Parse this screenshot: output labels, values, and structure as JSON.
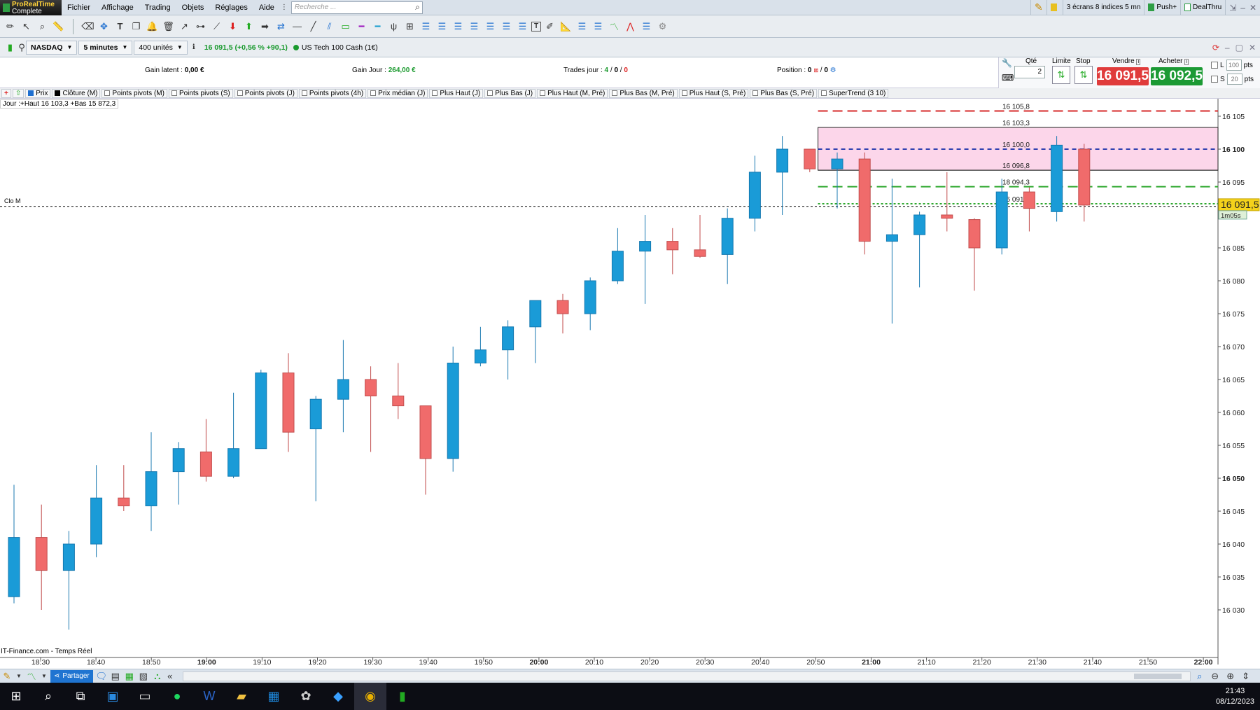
{
  "app": {
    "logo_title": "ProRealTime",
    "logo_sub": "Complete"
  },
  "menu": [
    "Fichier",
    "Affichage",
    "Trading",
    "Objets",
    "Réglages",
    "Aide"
  ],
  "search_placeholder": "Recherche ...",
  "topright": {
    "screens": "3 écrans 8 indices 5 mn",
    "push": "Push+",
    "dealthru": "DealThru"
  },
  "chart_header": {
    "instrument": "NASDAQ",
    "timeframe": "5 minutes",
    "units": "400 unités",
    "price_change": "16 091,5 (+0,56 % +90,1)",
    "instrument_name": "US Tech 100 Cash (1€)"
  },
  "trading": {
    "gain_latent_label": "Gain latent :",
    "gain_latent_value": "0,00 €",
    "gain_jour_label": "Gain Jour :",
    "gain_jour_value": "264,00 €",
    "trades_label": "Trades jour :",
    "trades_a": "4",
    "trades_b": "0",
    "trades_c": "0",
    "position_label": "Position :",
    "position_a": "0",
    "position_b": "0",
    "qty_label": "Qté",
    "qty_value": "2",
    "limit_label": "Limite",
    "stop_label": "Stop",
    "sell_label": "Vendre",
    "buy_label": "Acheter",
    "sell_price": "16 091,5",
    "buy_price": "16 092,5",
    "l_label": "L",
    "l_value": "100",
    "s_label": "S",
    "s_value": "20",
    "pts": "pts",
    "sell_color": "#e03b3b",
    "buy_color": "#1c9a34"
  },
  "indicators": [
    "Prix",
    "Clôture (M)",
    "Points pivots (M)",
    "Points pivots (S)",
    "Points pivots (J)",
    "Points pivots (4h)",
    "Prix médian (J)",
    "Plus Haut (J)",
    "Plus Bas (J)",
    "Plus Haut (M, Pré)",
    "Plus Bas (M, Pré)",
    "Plus Haut (S, Pré)",
    "Plus Bas (S, Pré)",
    "SuperTrend (3 10)"
  ],
  "chart_info": "Jour :+Haut 16 103,3 +Bas 15 872,3",
  "clo_label": "Clo M",
  "source": "IT-Finance.com - Temps Réel",
  "bottom": {
    "share": "Partager"
  },
  "clock": {
    "time": "21:43",
    "date": "08/12/2023"
  },
  "chart_data": {
    "type": "candlestick",
    "up_color": "#1a9bd7",
    "down_color": "#f06b6b",
    "ylim": [
      16026,
      16109
    ],
    "y_ticks": [
      {
        "v": 16030,
        "t": "16 030",
        "bold": false
      },
      {
        "v": 16035,
        "t": "16 035",
        "bold": false
      },
      {
        "v": 16040,
        "t": "16 040",
        "bold": false
      },
      {
        "v": 16045,
        "t": "16 045",
        "bold": false
      },
      {
        "v": 16050,
        "t": "16 050",
        "bold": true
      },
      {
        "v": 16055,
        "t": "16 055",
        "bold": false
      },
      {
        "v": 16060,
        "t": "16 060",
        "bold": false
      },
      {
        "v": 16065,
        "t": "16 065",
        "bold": false
      },
      {
        "v": 16070,
        "t": "16 070",
        "bold": false
      },
      {
        "v": 16075,
        "t": "16 075",
        "bold": false
      },
      {
        "v": 16080,
        "t": "16 080",
        "bold": false
      },
      {
        "v": 16085,
        "t": "16 085",
        "bold": false
      },
      {
        "v": 16090,
        "t": "16 090",
        "bold": false
      },
      {
        "v": 16095,
        "t": "16 095",
        "bold": false
      },
      {
        "v": 16100,
        "t": "16 100",
        "bold": true
      },
      {
        "v": 16105,
        "t": "16 105",
        "bold": false
      }
    ],
    "x_ticks": [
      {
        "i": 1,
        "t": "18:30",
        "bold": false
      },
      {
        "i": 3,
        "t": "18:40",
        "bold": false
      },
      {
        "i": 5,
        "t": "18:50",
        "bold": false
      },
      {
        "i": 7,
        "t": "19:00",
        "bold": true
      },
      {
        "i": 9,
        "t": "19:10",
        "bold": false
      },
      {
        "i": 11,
        "t": "19:20",
        "bold": false
      },
      {
        "i": 13,
        "t": "19:30",
        "bold": false
      },
      {
        "i": 15,
        "t": "19:40",
        "bold": false
      },
      {
        "i": 17,
        "t": "19:50",
        "bold": false
      },
      {
        "i": 19,
        "t": "20:00",
        "bold": true
      },
      {
        "i": 21,
        "t": "20:10",
        "bold": false
      },
      {
        "i": 23,
        "t": "20:20",
        "bold": false
      },
      {
        "i": 25,
        "t": "20:30",
        "bold": false
      },
      {
        "i": 27,
        "t": "20:40",
        "bold": false
      },
      {
        "i": 29,
        "t": "20:50",
        "bold": false
      },
      {
        "i": 31,
        "t": "21:00",
        "bold": true
      },
      {
        "i": 33,
        "t": "21:10",
        "bold": false
      },
      {
        "i": 35,
        "t": "21:20",
        "bold": false
      },
      {
        "i": 37,
        "t": "21:30",
        "bold": false
      },
      {
        "i": 39,
        "t": "21:40",
        "bold": false
      },
      {
        "i": 41,
        "t": "21:50",
        "bold": false
      },
      {
        "i": 43,
        "t": "22:00",
        "bold": true
      }
    ],
    "candles": [
      {
        "o": 16032,
        "h": 16049,
        "l": 16031,
        "c": 16041
      },
      {
        "o": 16041,
        "h": 16046,
        "l": 16030,
        "c": 16036
      },
      {
        "o": 16036,
        "h": 16042,
        "l": 16027,
        "c": 16040
      },
      {
        "o": 16040,
        "h": 16052,
        "l": 16038,
        "c": 16047
      },
      {
        "o": 16047,
        "h": 16052,
        "l": 16045,
        "c": 16045.8
      },
      {
        "o": 16045.8,
        "h": 16057,
        "l": 16042,
        "c": 16051
      },
      {
        "o": 16051,
        "h": 16055.5,
        "l": 16046,
        "c": 16054.5
      },
      {
        "o": 16054,
        "h": 16059,
        "l": 16049.5,
        "c": 16050.3
      },
      {
        "o": 16050.3,
        "h": 16063,
        "l": 16050,
        "c": 16054.5
      },
      {
        "o": 16054.5,
        "h": 16066.5,
        "l": 16054.5,
        "c": 16066
      },
      {
        "o": 16066,
        "h": 16069,
        "l": 16054,
        "c": 16057
      },
      {
        "o": 16057.5,
        "h": 16062.5,
        "l": 16046.5,
        "c": 16062
      },
      {
        "o": 16062,
        "h": 16071,
        "l": 16057,
        "c": 16065
      },
      {
        "o": 16065,
        "h": 16067,
        "l": 16054,
        "c": 16062.5
      },
      {
        "o": 16062.5,
        "h": 16067.5,
        "l": 16059,
        "c": 16061
      },
      {
        "o": 16061,
        "h": 16061,
        "l": 16047.5,
        "c": 16053
      },
      {
        "o": 16053,
        "h": 16070,
        "l": 16051,
        "c": 16067.5
      },
      {
        "o": 16067.5,
        "h": 16073,
        "l": 16067,
        "c": 16069.5
      },
      {
        "o": 16069.5,
        "h": 16074,
        "l": 16065,
        "c": 16073
      },
      {
        "o": 16073,
        "h": 16077,
        "l": 16067.5,
        "c": 16077
      },
      {
        "o": 16077,
        "h": 16078,
        "l": 16072,
        "c": 16075
      },
      {
        "o": 16075,
        "h": 16080.5,
        "l": 16072.5,
        "c": 16080
      },
      {
        "o": 16080,
        "h": 16088,
        "l": 16079.5,
        "c": 16084.5
      },
      {
        "o": 16084.5,
        "h": 16090,
        "l": 16076.5,
        "c": 16086
      },
      {
        "o": 16086,
        "h": 16088,
        "l": 16081,
        "c": 16084.7
      },
      {
        "o": 16084.7,
        "h": 16090,
        "l": 16083.5,
        "c": 16083.7
      },
      {
        "o": 16084,
        "h": 16091,
        "l": 16079.5,
        "c": 16089.5
      },
      {
        "o": 16089.5,
        "h": 16099,
        "l": 16087.5,
        "c": 16096.5
      },
      {
        "o": 16096.5,
        "h": 16102,
        "l": 16090,
        "c": 16100
      },
      {
        "o": 16100,
        "h": 16100,
        "l": 16096.5,
        "c": 16097
      },
      {
        "o": 16097,
        "h": 16099.5,
        "l": 16091,
        "c": 16098.5
      },
      {
        "o": 16098.5,
        "h": 16099.5,
        "l": 16084,
        "c": 16086
      },
      {
        "o": 16086,
        "h": 16095.5,
        "l": 16073.5,
        "c": 16087
      },
      {
        "o": 16087,
        "h": 16090.5,
        "l": 16079,
        "c": 16090
      },
      {
        "o": 16090,
        "h": 16096.5,
        "l": 16087.5,
        "c": 16089.5
      },
      {
        "o": 16089.3,
        "h": 16089.5,
        "l": 16078.5,
        "c": 16085
      },
      {
        "o": 16085,
        "h": 16095.5,
        "l": 16084,
        "c": 16093.5
      },
      {
        "o": 16093.5,
        "h": 16094.2,
        "l": 16087.5,
        "c": 16091
      },
      {
        "o": 16090.5,
        "h": 16102,
        "l": 16089,
        "c": 16100.6
      },
      {
        "o": 16100,
        "h": 16100.8,
        "l": 16089,
        "c": 16091.5
      }
    ],
    "levels": [
      {
        "v": 16105.8,
        "t": "16 105,8",
        "color": "#d62828",
        "dash": "14,7"
      },
      {
        "v": 16103.3,
        "t": "16 103,3",
        "color": "#222222",
        "dash": ""
      },
      {
        "v": 16100.0,
        "t": "16 100,0",
        "color": "#3040b0",
        "dash": "6,5"
      },
      {
        "v": 16096.8,
        "t": "16 096,8",
        "color": "#222222",
        "dash": ""
      },
      {
        "v": 16094.3,
        "t": "18 094,3",
        "color": "#2ea82e",
        "dash": "14,7"
      },
      {
        "v": 16091.7,
        "t": "16 091,7",
        "color": "#2ea82e",
        "dash": "3,3"
      }
    ],
    "zone": {
      "from": 16096.8,
      "to": 16103.3,
      "color": "#fcd6ea"
    },
    "clo_value": 16091.3,
    "last_price_label": "16 091,5",
    "countdown_label": "1m05s"
  }
}
